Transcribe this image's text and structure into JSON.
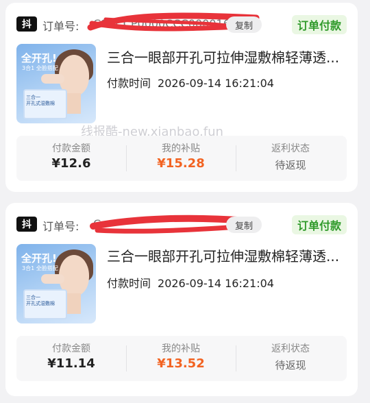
{
  "watermark": "线报酷-new.xianbao.fun",
  "colors": {
    "status_green": "#2f9a2a",
    "subsidy_orange": "#f26322",
    "badge_black": "#111111"
  },
  "orders": [
    {
      "platform_badge": "抖",
      "order_label": "订单号:",
      "order_number_visible": "C9CCCP0000CCC00001600",
      "copy_label": "复制",
      "status": "订单付款",
      "thumbnail": {
        "title": "全开孔!",
        "subtitle": "3合1 全脸搭配",
        "pack_text": "三合一\n开孔式湿敷棉"
      },
      "product_title": "三合一眼部开孔可拉伸湿敷棉轻薄透...",
      "pay_label": "付款时间",
      "pay_time": "2026-09-14 16:21:04",
      "stats": {
        "amount_label": "付款金额",
        "amount": "¥12.6",
        "subsidy_label": "我的补贴",
        "subsidy": "¥15.28",
        "rebate_label": "返利状态",
        "rebate_status": "待返现"
      }
    },
    {
      "platform_badge": "抖",
      "order_label": "订单号:",
      "order_number_visible": "C",
      "copy_label": "复制",
      "status": "订单付款",
      "thumbnail": {
        "title": "全开孔!",
        "subtitle": "3合1 全脸搭配",
        "pack_text": "三合一\n开孔式湿敷棉"
      },
      "product_title": "三合一眼部开孔可拉伸湿敷棉轻薄透...",
      "pay_label": "付款时间",
      "pay_time": "2026-09-14 16:21:04",
      "stats": {
        "amount_label": "付款金额",
        "amount": "¥11.14",
        "subsidy_label": "我的补贴",
        "subsidy": "¥13.52",
        "rebate_label": "返利状态",
        "rebate_status": "待返现"
      }
    }
  ]
}
